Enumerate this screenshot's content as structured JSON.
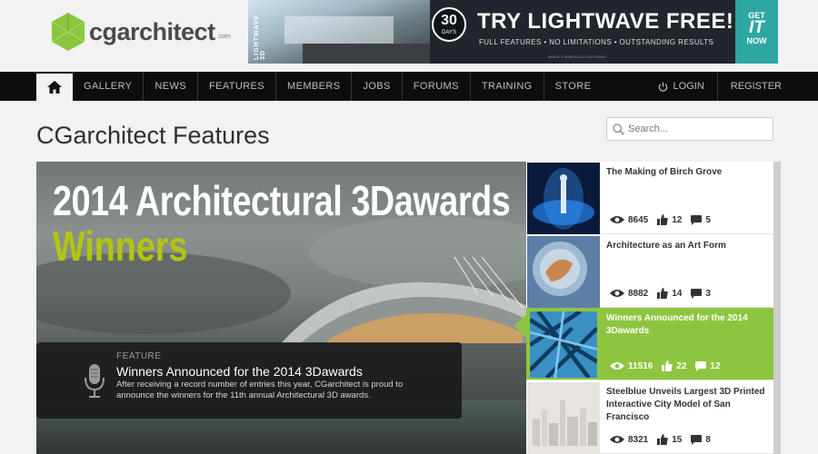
{
  "logo": {
    "text_cg": "cg",
    "text_rest": "architect",
    "suffix": ".com"
  },
  "banner": {
    "vertical_text": "LIGHTWAVE 3D",
    "days_number": "30",
    "days_label": "DAYS",
    "title": "TRY LIGHTWAVE FREE!",
    "subtitle": "FULL FEATURES • NO LIMITATIONS • OUTSTANDING RESULTS",
    "credit": "IMAGE © MARCELLO SOLFERINO",
    "cta_top": "GET",
    "cta_mid": "IT",
    "cta_bottom": "NOW",
    "accent_color": "#2ea7a3"
  },
  "nav": {
    "home_icon": "home-icon",
    "items": [
      "GALLERY",
      "NEWS",
      "FEATURES",
      "MEMBERS",
      "JOBS",
      "FORUMS",
      "TRAINING",
      "STORE"
    ],
    "login": "LOGIN",
    "register": "REGISTER"
  },
  "page": {
    "title": "CGarchitect Features"
  },
  "search": {
    "placeholder": "Search..."
  },
  "hero": {
    "headline_line1": "2014 Architectural 3Dawards",
    "headline_line2": "Winners",
    "headline_accent": "#b5c40f",
    "kicker": "FEATURE",
    "title": "Winners Announced for the 2014 3Dawards",
    "description": "After receiving a record number of entries this year, CGarchitect is proud to announce the winners for the 11th annual Architectural 3D awards."
  },
  "side": {
    "active_color": "#8dc540",
    "items": [
      {
        "title": "The Making of Birch Grove",
        "views": "8645",
        "likes": "12",
        "comments": "5"
      },
      {
        "title": "Architecture as an Art Form",
        "views": "8882",
        "likes": "14",
        "comments": "3"
      },
      {
        "title": "Winners Announced for the 2014 3Dawards",
        "views": "11516",
        "likes": "22",
        "comments": "12"
      },
      {
        "title": "Steelblue Unveils Largest 3D Printed Interactive City Model of San Francisco",
        "views": "8321",
        "likes": "15",
        "comments": "8"
      }
    ]
  }
}
